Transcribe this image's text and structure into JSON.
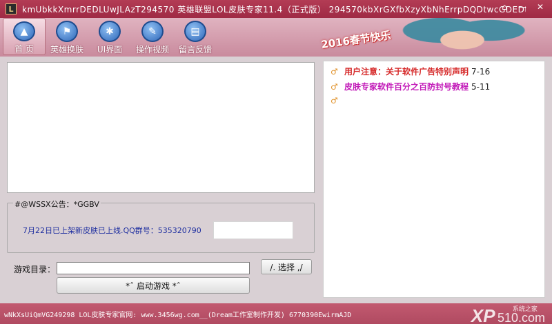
{
  "window": {
    "title": "kmUbkkXmrrDEDLUwJLAzT294570  英雄联盟LOL皮肤专家11.4（正式版） 294570kbXrGXfbXzyXbNhErrpDQDtwcGDEDt",
    "app_icon_letter": "L"
  },
  "nav": [
    {
      "label": "首 页",
      "icon": "compass-icon"
    },
    {
      "label": "英雄换肤",
      "icon": "flag-icon"
    },
    {
      "label": "UI界面",
      "icon": "spider-icon"
    },
    {
      "label": "操作视频",
      "icon": "wrench-icon"
    },
    {
      "label": "留言反馈",
      "icon": "book-icon"
    }
  ],
  "banner": {
    "text": "2016春节快乐"
  },
  "notice": {
    "legend": "#@WSSX公告：*GGBV",
    "text": "7月22日已上架新皮肤已上线.QQ群号：535320790"
  },
  "game_dir": {
    "label": "游戏目录：",
    "value": "",
    "choose_label": "/. 选择 ,/",
    "start_label": "*ˆ 启动游戏  *ˆ"
  },
  "news": [
    {
      "title": "用户注意：关于软件广告特别声明",
      "date": "7-16",
      "color": "#d62a2a"
    },
    {
      "title": "皮肤专家软件百分之百防封号教程",
      "date": "5-11",
      "color": "#c21ab8"
    },
    {
      "title": "",
      "date": "",
      "color": "#000000"
    }
  ],
  "status": {
    "text": "wNkXsUiQmVG249298  LOL皮肤专家官网: www.3456wg.com__(Dream工作室制作开发)  6770390EwirmAJD"
  },
  "watermark": {
    "brand": "XP",
    "domain": "510.com",
    "tag": "系统之家"
  }
}
